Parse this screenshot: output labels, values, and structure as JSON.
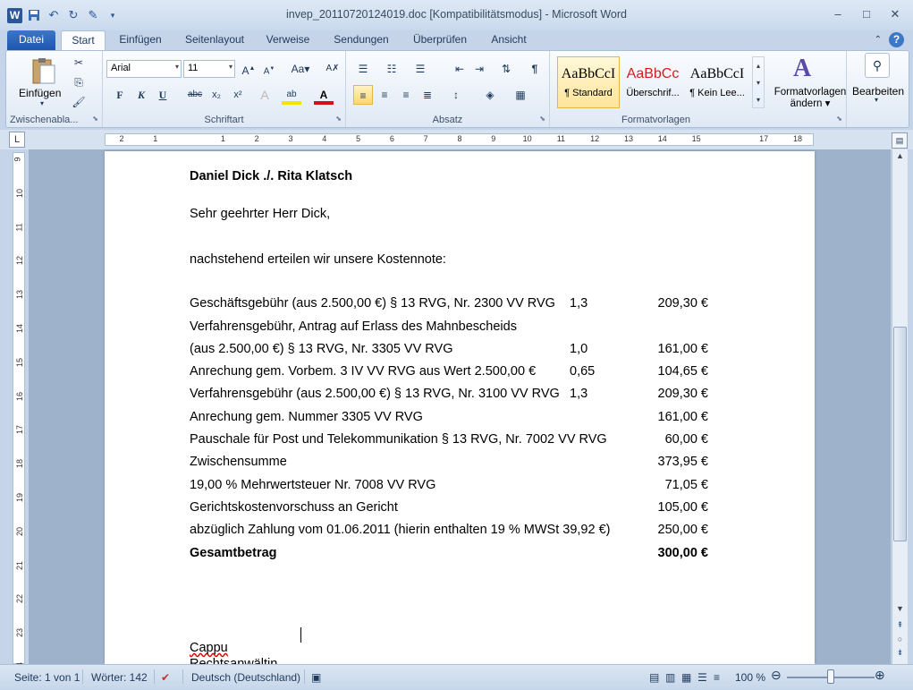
{
  "window": {
    "title": "invep_20110720124019.doc [Kompatibilitätsmodus]  -  Microsoft Word",
    "minimize": "–",
    "maximize": "□",
    "close": "✕"
  },
  "tabs": {
    "file": "Datei",
    "items": [
      "Start",
      "Einfügen",
      "Seitenlayout",
      "Verweise",
      "Sendungen",
      "Überprüfen",
      "Ansicht"
    ]
  },
  "ribbon": {
    "clipboard": {
      "paste": "Einfügen",
      "label": "Zwischenabla..."
    },
    "font": {
      "name": "Arial",
      "size": "11",
      "label": "Schriftart"
    },
    "paragraph": {
      "label": "Absatz"
    },
    "styles": {
      "label": "Formatvorlagen",
      "items": [
        {
          "sample": "AaBbCcI",
          "name": "¶ Standard"
        },
        {
          "sample": "AaBbCc",
          "name": "Überschrif..."
        },
        {
          "sample": "AaBbCcI",
          "name": "¶ Kein Lee..."
        }
      ],
      "change": "Formatvorlagen",
      "change2": "ändern"
    },
    "edit": {
      "label": "Bearbeiten"
    }
  },
  "document": {
    "subject": "Daniel Dick ./. Rita Klatsch",
    "greeting": "Sehr geehrter Herr Dick,",
    "intro": "nachstehend erteilen wir unsere Kostennote:",
    "rows": [
      {
        "text": "Geschäftsgebühr (aus 2.500,00 €) § 13 RVG, Nr. 2300 VV RVG",
        "factor": "1,3",
        "amount": "209,30 €"
      },
      {
        "text": "Verfahrensgebühr, Antrag auf Erlass des Mahnbescheids",
        "factor": "",
        "amount": ""
      },
      {
        "text": "(aus 2.500,00 €) § 13 RVG, Nr. 3305 VV RVG",
        "factor": "1,0",
        "amount": "161,00 €"
      },
      {
        "text": "Anrechung gem. Vorbem. 3 IV VV RVG aus Wert 2.500,00 €",
        "factor": "0,65",
        "amount": "104,65 €"
      },
      {
        "text": "Verfahrensgebühr (aus 2.500,00 €) § 13 RVG, Nr. 3100 VV RVG",
        "factor": "1,3",
        "amount": "209,30 €"
      },
      {
        "text": "Anrechung gem. Nummer 3305 VV RVG",
        "factor": "",
        "amount": "161,00 €"
      },
      {
        "text": "Pauschale für Post und Telekommunikation § 13 RVG, Nr. 7002 VV RVG",
        "factor": "",
        "amount": "60,00 €"
      },
      {
        "text": "Zwischensumme",
        "factor": "",
        "amount": "373,95 €"
      },
      {
        "text": "19,00 % Mehrwertsteuer Nr. 7008 VV RVG",
        "factor": "",
        "amount": "71,05 €"
      },
      {
        "text": "Gerichtskostenvorschuss an Gericht",
        "factor": "",
        "amount": "105,00 €"
      },
      {
        "text": "abzüglich Zahlung vom 01.06.2011 (hierin enthalten 19 % MWSt 39,92 €)",
        "factor": "",
        "amount": "250,00 €"
      }
    ],
    "total_label": "Gesamtbetrag",
    "total_amount": "300,00 €",
    "sign_name": "Cappu",
    "sign_title": "Rechtsanwältin"
  },
  "status": {
    "page": "Seite: 1 von 1",
    "words": "Wörter: 142",
    "language": "Deutsch (Deutschland)",
    "zoom": "100 %"
  }
}
